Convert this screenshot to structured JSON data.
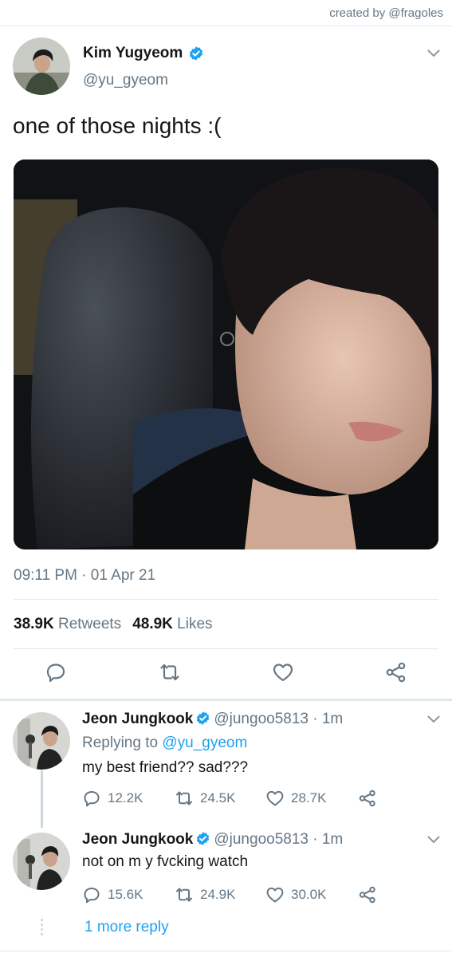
{
  "credit": "created by @fragoles",
  "tweet": {
    "author_name": "Kim Yugyeom",
    "author_handle": "@yu_gyeom",
    "verified": true,
    "text": "one of those nights :(",
    "timestamp": "09:11 PM · 01 Apr 21",
    "retweets_count": "38.9K",
    "retweets_label": "Retweets",
    "likes_count": "48.9K",
    "likes_label": "Likes"
  },
  "actions": {
    "icons": [
      "reply-icon",
      "retweet-icon",
      "like-icon",
      "share-icon"
    ]
  },
  "replies": [
    {
      "author_name": "Jeon Jungkook",
      "handle_time": "@jungoo5813 · 1m",
      "verified": true,
      "replying_prefix": "Replying to",
      "replying_to": "@yu_gyeom",
      "text": "my best friend?? sad???",
      "reply_count": "12.2K",
      "retweet_count": "24.5K",
      "like_count": "28.7K"
    },
    {
      "author_name": "Jeon Jungkook",
      "handle_time": "@jungoo5813 · 1m",
      "verified": true,
      "text": "not on m y fvcking watch",
      "reply_count": "15.6K",
      "retweet_count": "24.9K",
      "like_count": "30.0K"
    }
  ],
  "more_replies": "1 more reply",
  "colors": {
    "accent": "#1da1f2",
    "text": "#14171a",
    "secondary": "#657786",
    "divider": "#e1e8ed"
  }
}
